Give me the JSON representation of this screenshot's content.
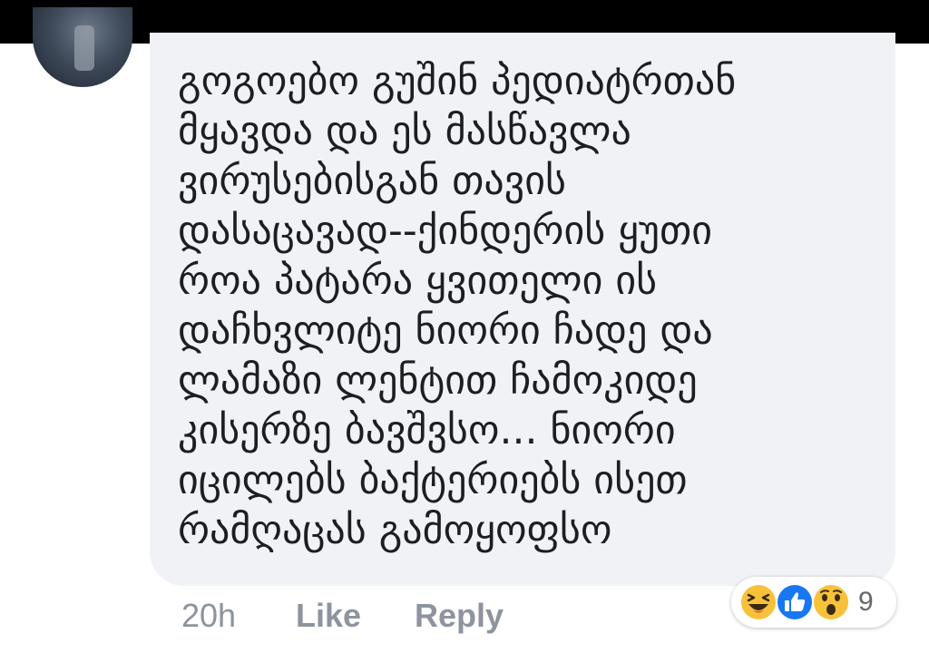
{
  "comment": {
    "lines": [
      "გოგოებო გუშინ პედიატრთან",
      "მყავდა და ეს მასწავლა",
      "ვირუსებისგან თავის",
      "დასაცავად--ქინდერის ყუთი",
      "როა პატარა ყვითელი ის",
      "დაჩხვლიტე ნიორი ჩადე და",
      "ლამაზი ლენტით ჩამოკიდე",
      "კისერზე ბავშვსო... ნიორი",
      "იცილებს ბაქტერიებს ისეთ",
      "რამღაცას გამოყოფსო"
    ]
  },
  "meta": {
    "time": "20h",
    "like_label": "Like",
    "reply_label": "Reply"
  },
  "reactions": {
    "icons": [
      "haha-icon",
      "like-icon",
      "wow-icon"
    ],
    "count": "9"
  },
  "colors": {
    "bubble_bg": "#f0f2f5",
    "meta_text": "#8d949e",
    "like_blue": "#1877f2",
    "emoji_yellow": "#f7c23a"
  }
}
